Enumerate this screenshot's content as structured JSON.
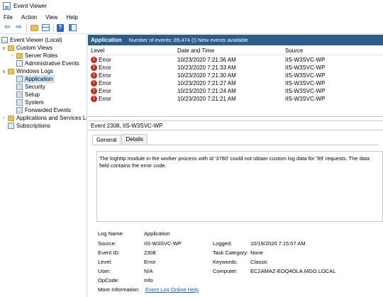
{
  "window": {
    "title": "Event Viewer"
  },
  "menu": [
    "File",
    "Action",
    "View",
    "Help"
  ],
  "tree": {
    "root": "Event Viewer (Local)",
    "custom_views": "Custom Views",
    "server_roles": "Server Roles",
    "admin_events": "Administrative Events",
    "windows_logs": "Windows Logs",
    "application": "Application",
    "security": "Security",
    "setup": "Setup",
    "system": "System",
    "forwarded": "Forwarded Events",
    "apps_services": "Applications and Services Lo",
    "subscriptions": "Subscriptions"
  },
  "header": {
    "title": "Application",
    "count": "Number of events: 89,474 (!) New events available"
  },
  "columns": {
    "level": "Level",
    "date": "Date and Time",
    "source": "Source"
  },
  "events": [
    {
      "level": "Error",
      "date": "10/23/2020 7:21:36 AM",
      "source": "IIS-W3SVC-WP"
    },
    {
      "level": "Error",
      "date": "10/23/2020 7:21:33 AM",
      "source": "IIS-W3SVC-WP"
    },
    {
      "level": "Error",
      "date": "10/23/2020 7:21:30 AM",
      "source": "IIS-W3SVC-WP"
    },
    {
      "level": "Error",
      "date": "10/23/2020 7:21:27 AM",
      "source": "IIS-W3SVC-WP"
    },
    {
      "level": "Error",
      "date": "10/23/2020 7:21:24 AM",
      "source": "IIS-W3SVC-WP"
    },
    {
      "level": "Error",
      "date": "10/23/2020 7:21:21 AM",
      "source": "IIS-W3SVC-WP"
    }
  ],
  "detail": {
    "title": "Event 2308, IIS-W3SVC-WP",
    "tabs": [
      "General",
      "Details"
    ],
    "description": "The loghttp module in the worker process with id '3780' could not obtain custom log data for '99' requests. The data field contains the error code.",
    "props": {
      "log_name_label": "Log Name:",
      "log_name": "Application",
      "source_label": "Source:",
      "source": "IIS-W3SVC-WP",
      "logged_label": "Logged:",
      "logged": "10/19/2020 7:15:07 AM",
      "event_id_label": "Event ID:",
      "event_id": "2308",
      "task_label": "Task Category:",
      "task": "None",
      "level_label": "Level:",
      "level": "Error",
      "keywords_label": "Keywords:",
      "keywords": "Classic",
      "user_label": "User:",
      "user": "N/A",
      "computer_label": "Computer:",
      "computer": "EC2AMAZ-EOQ4OLA.MGO.LOCAL",
      "opcode_label": "OpCode:",
      "opcode": "Info",
      "more_label": "More Information:",
      "more_link": "Event Log Online Help"
    }
  }
}
